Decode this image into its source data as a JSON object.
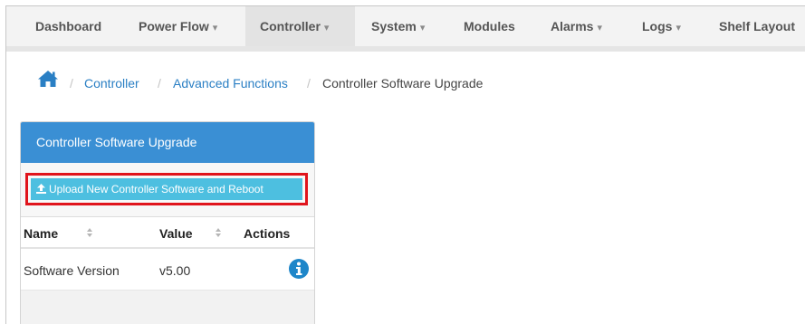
{
  "nav": {
    "items": [
      {
        "label": "Dashboard",
        "has_caret": false
      },
      {
        "label": "Power Flow",
        "has_caret": true
      },
      {
        "label": "Controller",
        "has_caret": true,
        "active": true
      },
      {
        "label": "System",
        "has_caret": true
      },
      {
        "label": "Modules",
        "has_caret": false
      },
      {
        "label": "Alarms",
        "has_caret": true
      },
      {
        "label": "Logs",
        "has_caret": true
      },
      {
        "label": "Shelf Layout",
        "has_caret": false
      }
    ],
    "caret_glyph": "▾"
  },
  "breadcrumb": {
    "home_icon": "home-icon",
    "separator": "/",
    "items": [
      {
        "label": "Controller",
        "link": true
      },
      {
        "label": "Advanced Functions",
        "link": true
      },
      {
        "label": "Controller Software Upgrade",
        "link": false
      }
    ]
  },
  "panel": {
    "title": "Controller Software Upgrade",
    "upload_button": {
      "label": "Upload New Controller Software and Reboot",
      "icon": "upload-icon"
    },
    "table": {
      "columns": [
        {
          "label": "Name",
          "sortable": true
        },
        {
          "label": "Value",
          "sortable": true
        },
        {
          "label": "Actions",
          "sortable": false
        }
      ],
      "rows": [
        {
          "name": "Software Version",
          "value": "v5.00",
          "action_icon": "info-icon"
        }
      ]
    }
  },
  "colors": {
    "panel_header": "#3a8fd4",
    "upload_button": "#4dbfe0",
    "highlight_border": "#e0141c",
    "link": "#2a7fc4",
    "info_icon": "#1e86c9"
  }
}
